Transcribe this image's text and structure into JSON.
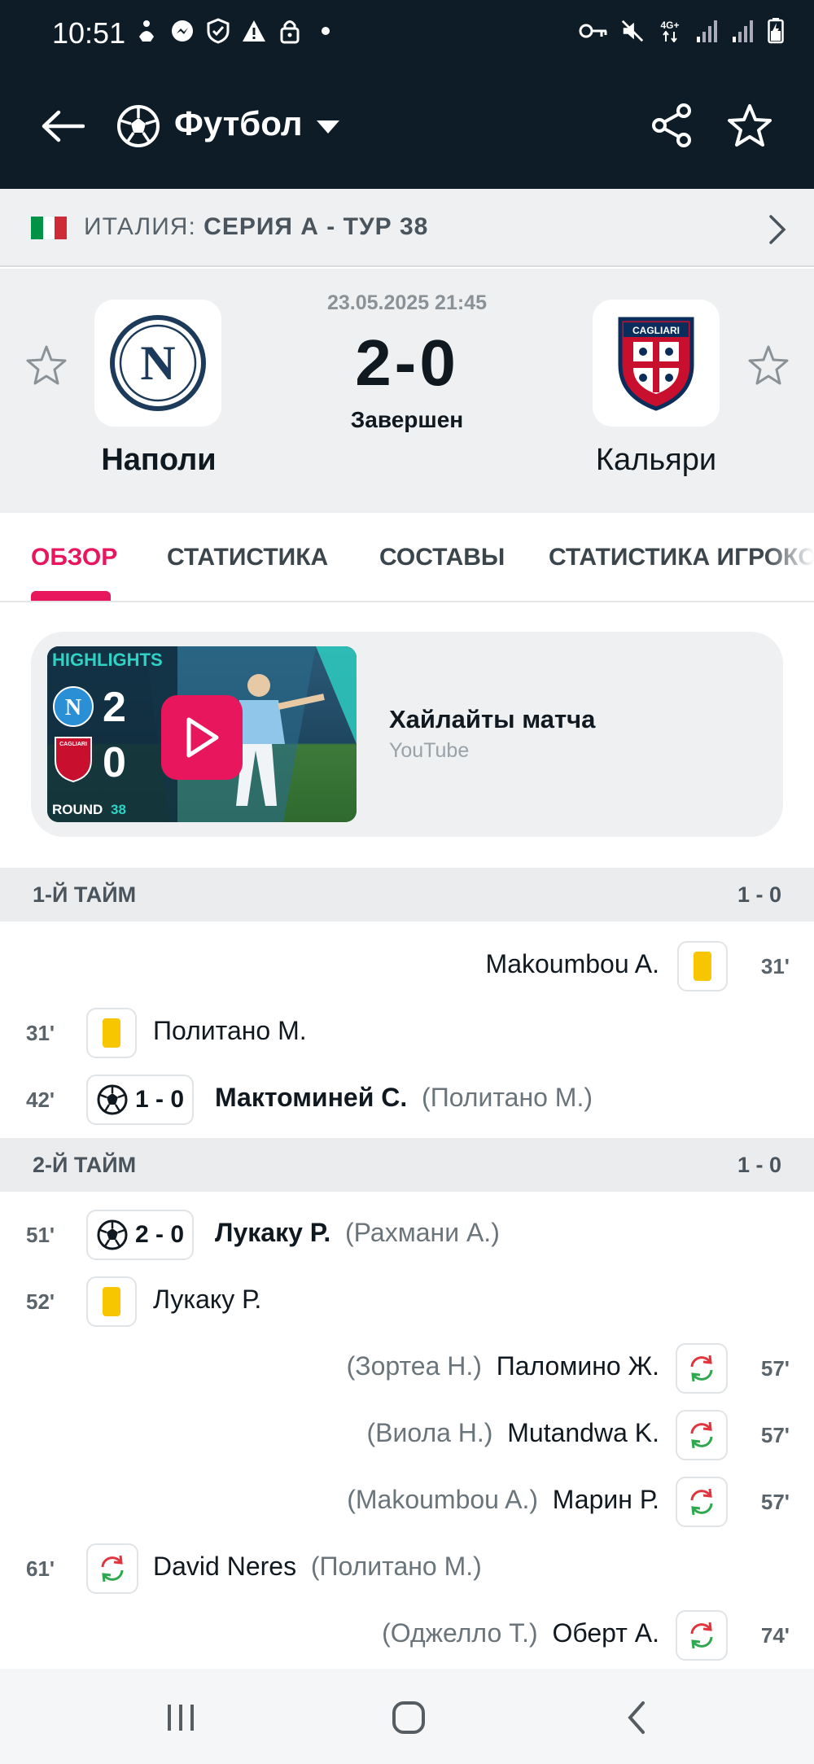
{
  "status_bar": {
    "time": "10:51",
    "left_icons": [
      "accessibility-icon",
      "messenger-icon",
      "shield-icon",
      "warning-icon",
      "lock-icon",
      "dot-icon"
    ],
    "right_icons": [
      "vpn-key-icon",
      "mute-icon",
      "network-4g-icon",
      "signal-icon",
      "signal-icon",
      "battery-icon"
    ],
    "network_label": "4G+"
  },
  "app_bar": {
    "sport_title": "Футбол",
    "back_icon": "back-arrow-icon",
    "share_icon": "share-icon",
    "favorite_icon": "star-outline-icon"
  },
  "league": {
    "country": "ИТАЛИЯ:",
    "competition": "СЕРИЯ А - ТУР 38",
    "flag_colors": [
      "#009246",
      "#ffffff",
      "#ce2b37"
    ]
  },
  "match": {
    "datetime": "23.05.2025 21:45",
    "score": "2-0",
    "status": "Завершен",
    "home_team": "Наполи",
    "away_team": "Кальяри",
    "home_logo_letter": "N",
    "away_logo_text": "CAGLIARI"
  },
  "tabs": [
    {
      "label": "ОБЗОР",
      "active": true
    },
    {
      "label": "СТАТИСТИКА",
      "active": false
    },
    {
      "label": "СОСТАВЫ",
      "active": false
    },
    {
      "label": "СТАТИСТИКА ИГРОКОВ",
      "active": false
    }
  ],
  "highlights": {
    "title": "Хайлайты матча",
    "source": "YouTube",
    "thumb_badge": "HIGHLIGHTS",
    "thumb_home_goals": "2",
    "thumb_away_goals": "0",
    "thumb_round": "ROUND",
    "thumb_round_num": "38",
    "thumb_away_badge": "CAGLIARI"
  },
  "halves": [
    {
      "label": "1-Й ТАЙМ",
      "score": "1 - 0"
    },
    {
      "label": "2-Й ТАЙМ",
      "score": "1 - 0"
    }
  ],
  "events_first_half": [
    {
      "side": "away",
      "type": "yellow",
      "minute": "31'",
      "player": "Makoumbou A.",
      "assist": ""
    },
    {
      "side": "home",
      "type": "yellow",
      "minute": "31'",
      "player": "Политано М.",
      "assist": ""
    },
    {
      "side": "home",
      "type": "goal",
      "minute": "42'",
      "score": "1 - 0",
      "player": "Мактоминей С.",
      "assist": "(Политано М.)"
    }
  ],
  "events_second_half": [
    {
      "side": "home",
      "type": "goal",
      "minute": "51'",
      "score": "2 - 0",
      "player": "Лукаку Р.",
      "assist": "(Рахмани А.)"
    },
    {
      "side": "home",
      "type": "yellow",
      "minute": "52'",
      "player": "Лукаку Р.",
      "assist": ""
    },
    {
      "side": "away",
      "type": "sub",
      "minute": "57'",
      "player": "Паломино Ж.",
      "assist": "(Зортеа Н.)"
    },
    {
      "side": "away",
      "type": "sub",
      "minute": "57'",
      "player": "Mutandwa K.",
      "assist": "(Виола Н.)"
    },
    {
      "side": "away",
      "type": "sub",
      "minute": "57'",
      "player": "Марин Р.",
      "assist": "(Makoumbou A.)"
    },
    {
      "side": "home",
      "type": "sub",
      "minute": "61'",
      "player": "David Neres",
      "assist": "(Политано М.)"
    },
    {
      "side": "away",
      "type": "sub",
      "minute": "74'",
      "player": "Оберт А.",
      "assist": "(Оджелло Т.)"
    }
  ],
  "nav_bar": {
    "buttons": [
      "recent-apps-icon",
      "home-icon",
      "back-icon"
    ]
  },
  "colors": {
    "accent": "#e8175d",
    "header_bg": "#0d1c26",
    "yellow_card": "#f7c600",
    "sub_in": "#2fa84f",
    "sub_out": "#e0353d"
  }
}
